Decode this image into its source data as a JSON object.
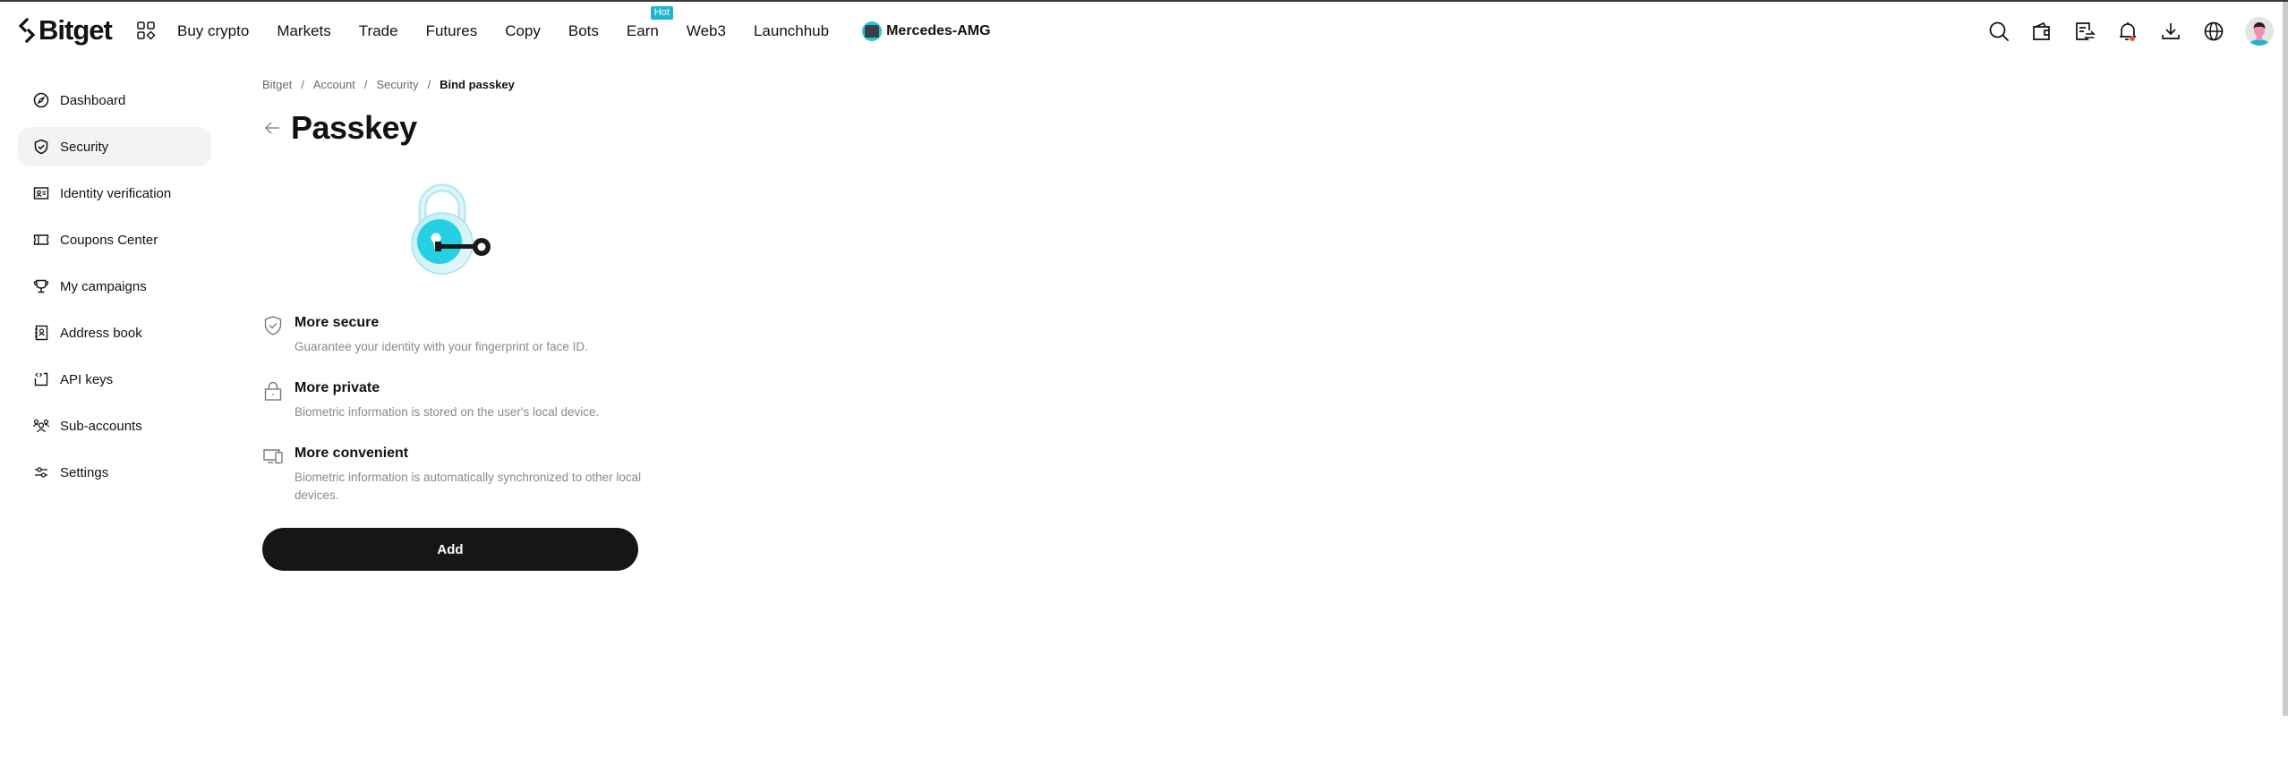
{
  "header": {
    "brand": "Bitget",
    "nav": [
      {
        "label": "Buy crypto"
      },
      {
        "label": "Markets"
      },
      {
        "label": "Trade"
      },
      {
        "label": "Futures"
      },
      {
        "label": "Copy"
      },
      {
        "label": "Bots"
      },
      {
        "label": "Earn",
        "badge": "Hot"
      },
      {
        "label": "Web3"
      },
      {
        "label": "Launchhub"
      }
    ],
    "partner": "Mercedes-AMG",
    "icons": [
      "search-icon",
      "wallet-icon",
      "orders-icon",
      "bell-icon",
      "download-icon",
      "globe-icon",
      "avatar"
    ],
    "badge_color": "#1fb5d0",
    "notification_dot_color": "#e8553f"
  },
  "sidebar": {
    "items": [
      {
        "label": "Dashboard",
        "icon": "compass-icon",
        "active": false
      },
      {
        "label": "Security",
        "icon": "shield-check-icon",
        "active": true
      },
      {
        "label": "Identity verification",
        "icon": "id-card-icon",
        "active": false
      },
      {
        "label": "Coupons Center",
        "icon": "ticket-icon",
        "active": false
      },
      {
        "label": "My campaigns",
        "icon": "trophy-icon",
        "active": false
      },
      {
        "label": "Address book",
        "icon": "contact-book-icon",
        "active": false
      },
      {
        "label": "API keys",
        "icon": "api-key-icon",
        "active": false
      },
      {
        "label": "Sub-accounts",
        "icon": "users-icon",
        "active": false
      },
      {
        "label": "Settings",
        "icon": "sliders-icon",
        "active": false
      }
    ]
  },
  "breadcrumb": [
    "Bitget",
    "Account",
    "Security",
    "Bind passkey"
  ],
  "page": {
    "title": "Passkey",
    "illustration": "padlock-with-key",
    "features": [
      {
        "icon": "shield-check-icon",
        "title": "More secure",
        "desc": "Guarantee your identity with your fingerprint or face ID."
      },
      {
        "icon": "lock-icon",
        "title": "More private",
        "desc": "Biometric information is stored on the user's local device."
      },
      {
        "icon": "devices-icon",
        "title": "More convenient",
        "desc": "Biometric information is automatically synchronized to other local devices."
      }
    ],
    "add_button": "Add"
  }
}
